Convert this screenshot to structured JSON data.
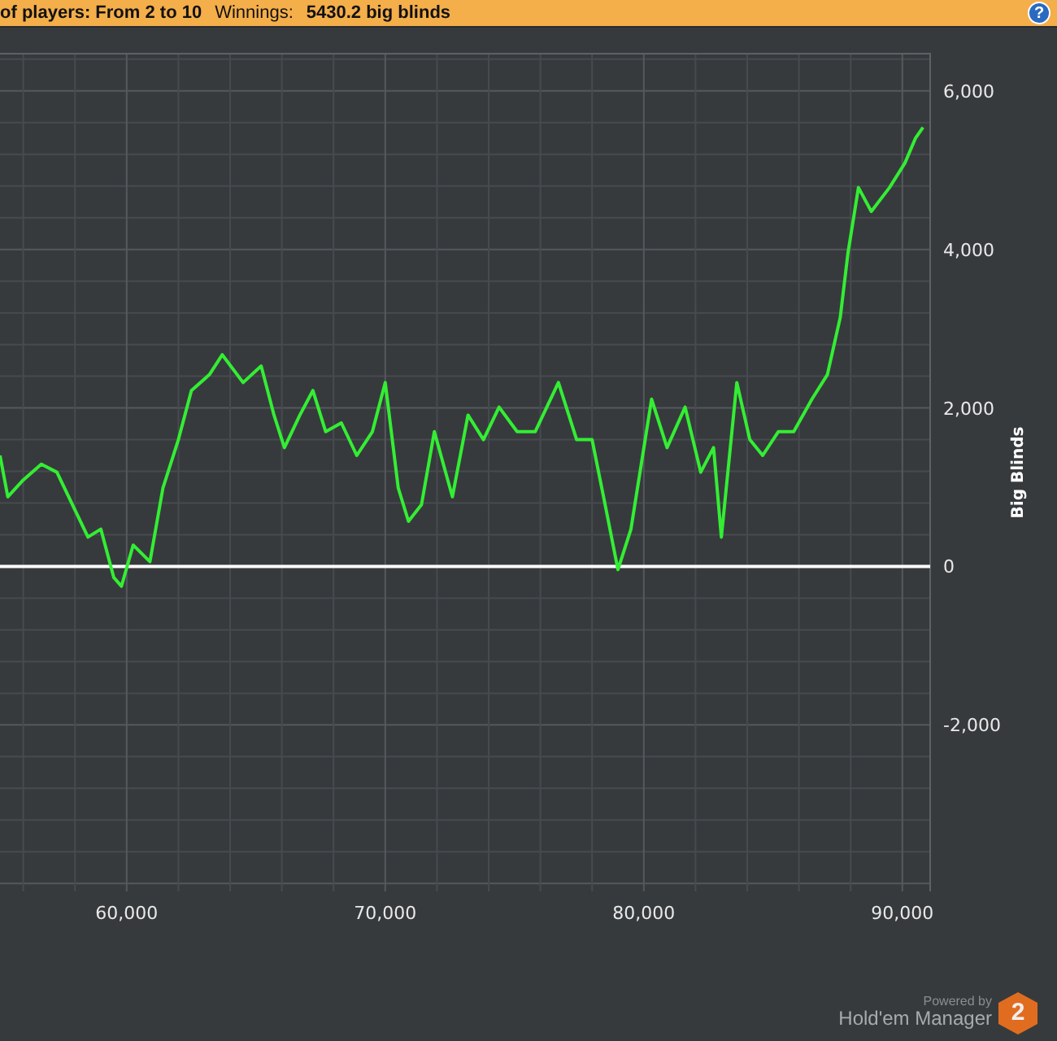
{
  "header": {
    "players_filter": "of players: From 2 to 10",
    "winnings_label": "Winnings:",
    "winnings_value": "5430.2 big blinds",
    "help_button": "?"
  },
  "chart": {
    "chart_data": {
      "type": "line",
      "ylabel": "Big Blinds",
      "xlim": [
        55100,
        91075
      ],
      "ylim": [
        -4100,
        6470
      ],
      "xticks": [
        {
          "value": 60000,
          "label": "60,000"
        },
        {
          "value": 70000,
          "label": "70,000"
        },
        {
          "value": 80000,
          "label": "80,000"
        },
        {
          "value": 90000,
          "label": "90,000"
        }
      ],
      "yticks": [
        {
          "value": 6000,
          "label": "6,000"
        },
        {
          "value": 4000,
          "label": "4,000"
        },
        {
          "value": 2000,
          "label": "2,000"
        },
        {
          "value": 0,
          "label": "0"
        },
        {
          "value": -2000,
          "label": "-2,000"
        }
      ],
      "x": [
        55100,
        55400,
        56000,
        56700,
        57300,
        57900,
        58500,
        59000,
        59500,
        59800,
        60250,
        60900,
        61400,
        62000,
        62500,
        63200,
        63700,
        64500,
        65200,
        65700,
        66100,
        66700,
        67200,
        67700,
        68300,
        68900,
        69500,
        70000,
        70500,
        70900,
        71400,
        71900,
        72600,
        73200,
        73800,
        74400,
        75100,
        75800,
        76700,
        77400,
        78000,
        78500,
        79000,
        79500,
        80300,
        80900,
        81600,
        82200,
        82700,
        83000,
        83600,
        84100,
        84600,
        85200,
        85800,
        86500,
        87100,
        87600,
        87900,
        88300,
        88800,
        89500,
        90100,
        90500,
        90800
      ],
      "series": [
        {
          "color": "#33ee33",
          "values": [
            1400,
            880,
            1090,
            1290,
            1190,
            780,
            370,
            470,
            -140,
            -250,
            270,
            60,
            990,
            1600,
            2220,
            2420,
            2670,
            2320,
            2530,
            1910,
            1500,
            1910,
            2220,
            1700,
            1810,
            1400,
            1700,
            2320,
            990,
            570,
            780,
            1700,
            880,
            1910,
            1600,
            2010,
            1700,
            1700,
            2320,
            1600,
            1600,
            780,
            -40,
            470,
            2110,
            1500,
            2010,
            1190,
            1500,
            370,
            2320,
            1600,
            1400,
            1700,
            1700,
            2110,
            2420,
            3140,
            3960,
            4780,
            4480,
            4780,
            5090,
            5400,
            5540
          ]
        }
      ],
      "grid": true,
      "ref_lines": [
        {
          "axis": "y",
          "value": 0
        }
      ]
    }
  },
  "branding": {
    "powered_by": "Powered by",
    "product": "Hold'em Manager",
    "badge": "2"
  }
}
